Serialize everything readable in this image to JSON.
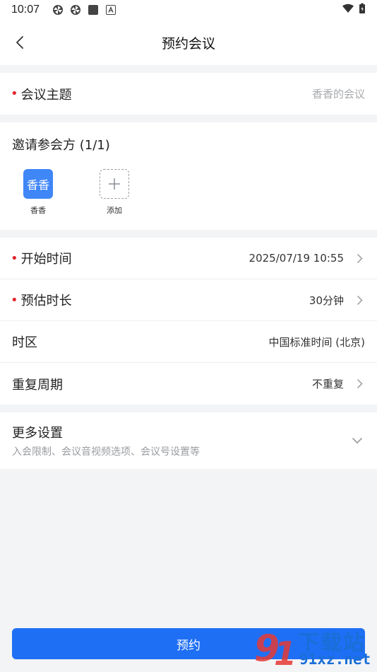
{
  "status_bar": {
    "time": "10:07",
    "icons": [
      "pinwheel-icon",
      "pinwheel-icon",
      "square-icon",
      "a-badge-icon"
    ],
    "right_icons": [
      "wifi-icon",
      "battery-icon"
    ]
  },
  "nav": {
    "title": "预约会议",
    "back_icon": "chevron-left-icon"
  },
  "subject": {
    "label": "会议主题",
    "placeholder": "香香的会议",
    "required": true
  },
  "invite": {
    "title": "邀请参会方 (1/1)",
    "members": [
      {
        "avatar_text": "香香",
        "name": "香香"
      }
    ],
    "add_label": "添加"
  },
  "settings": [
    {
      "label": "开始时间",
      "value": "2025/07/19 10:55",
      "required": true,
      "has_arrow": true
    },
    {
      "label": "预估时长",
      "value": "30分钟",
      "required": true,
      "has_arrow": true
    },
    {
      "label": "时区",
      "value": "中国标准时间 (北京)",
      "required": false,
      "has_arrow": false
    },
    {
      "label": "重复周期",
      "value": "不重复",
      "required": false,
      "has_arrow": true
    }
  ],
  "more": {
    "title": "更多设置",
    "subtitle": "入会限制、会议音视频选项、会议号设置等"
  },
  "submit_label": "预约",
  "watermark": {
    "text_top": "下载站",
    "text_bottom": "91xz.net"
  },
  "colors": {
    "primary": "#1f6ff5",
    "avatar": "#3f86f7",
    "required_dot": "#e0262d",
    "background": "#f3f4f6"
  }
}
